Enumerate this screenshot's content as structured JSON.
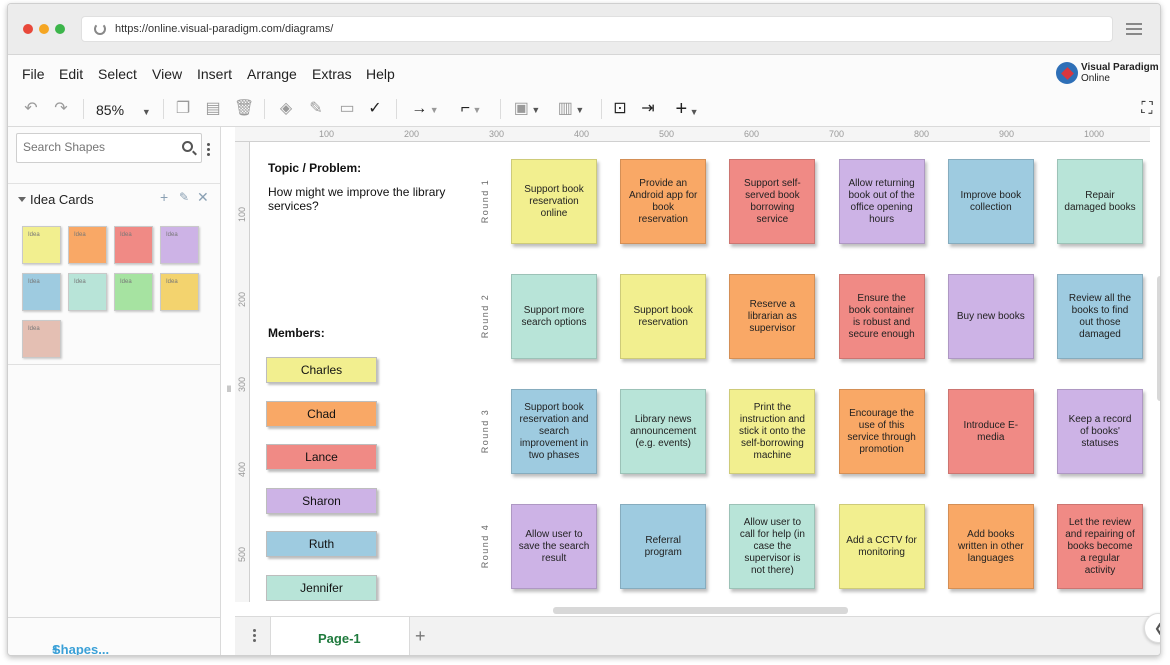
{
  "browser": {
    "url": "https://online.visual-paradigm.com/diagrams/",
    "dot_colors": [
      "#e8483a",
      "#f5a623",
      "#3cb54a"
    ]
  },
  "menu": [
    "File",
    "Edit",
    "Select",
    "View",
    "Insert",
    "Arrange",
    "Extras",
    "Help"
  ],
  "logo": {
    "line1": "Visual Paradigm",
    "line2": "Online"
  },
  "toolbar": {
    "zoom": "85%"
  },
  "sidebar": {
    "search_placeholder": "Search Shapes",
    "library_title": "Idea Cards",
    "thumb_label": "Idea",
    "thumb_colors": [
      "#f2ef8f",
      "#f9a866",
      "#f08a85",
      "#cdb3e6",
      "#9ecbe0",
      "#b8e4d8",
      "#a6e3a1",
      "#f3d36e",
      "#e4bfb3"
    ],
    "shapes_button": "Shapes..."
  },
  "ruler": {
    "top": [
      "100",
      "200",
      "300",
      "400",
      "500",
      "600",
      "700",
      "800",
      "900",
      "1000"
    ],
    "left": [
      "100",
      "200",
      "300",
      "400",
      "500"
    ]
  },
  "canvas": {
    "topic_label": "Topic / Problem:",
    "topic_text": "How might we improve the library services?",
    "members_label": "Members:",
    "members": [
      {
        "name": "Charles",
        "color": "#f2ef8f"
      },
      {
        "name": "Chad",
        "color": "#f9a866"
      },
      {
        "name": "Lance",
        "color": "#f08a85"
      },
      {
        "name": "Sharon",
        "color": "#cdb3e6"
      },
      {
        "name": "Ruth",
        "color": "#9ecbe0"
      },
      {
        "name": "Jennifer",
        "color": "#b8e4d8"
      }
    ],
    "rounds": [
      {
        "label": "Round 1",
        "cards": [
          {
            "text": "Support book reservation online",
            "color": "#f2ef8f"
          },
          {
            "text": "Provide an Android app for book reservation",
            "color": "#f9a866"
          },
          {
            "text": "Support self-served book borrowing service",
            "color": "#f08a85"
          },
          {
            "text": "Allow returning book out of the office opening hours",
            "color": "#cdb3e6"
          },
          {
            "text": "Improve book collection",
            "color": "#9ecbe0"
          },
          {
            "text": "Repair damaged books",
            "color": "#b8e4d8"
          }
        ]
      },
      {
        "label": "Round 2",
        "cards": [
          {
            "text": "Support more search options",
            "color": "#b8e4d8"
          },
          {
            "text": "Support book reservation",
            "color": "#f2ef8f"
          },
          {
            "text": "Reserve a librarian as supervisor",
            "color": "#f9a866"
          },
          {
            "text": "Ensure the book container is robust and secure enough",
            "color": "#f08a85"
          },
          {
            "text": "Buy new books",
            "color": "#cdb3e6"
          },
          {
            "text": "Review all the books to find out those damaged",
            "color": "#9ecbe0"
          }
        ]
      },
      {
        "label": "Round 3",
        "cards": [
          {
            "text": "Support book reservation and search improvement in two phases",
            "color": "#9ecbe0"
          },
          {
            "text": "Library news announcement (e.g. events)",
            "color": "#b8e4d8"
          },
          {
            "text": "Print the instruction and stick it onto the self-borrowing machine",
            "color": "#f2ef8f"
          },
          {
            "text": "Encourage the use of this service through promotion",
            "color": "#f9a866"
          },
          {
            "text": "Introduce E-media",
            "color": "#f08a85"
          },
          {
            "text": "Keep a record of books' statuses",
            "color": "#cdb3e6"
          }
        ]
      },
      {
        "label": "Round 4",
        "cards": [
          {
            "text": "Allow user to save the search result",
            "color": "#cdb3e6"
          },
          {
            "text": "Referral program",
            "color": "#9ecbe0"
          },
          {
            "text": "Allow user to call for help (in case the supervisor is not there)",
            "color": "#b8e4d8"
          },
          {
            "text": "Add a CCTV for monitoring",
            "color": "#f2ef8f"
          },
          {
            "text": "Add books written in other languages",
            "color": "#f9a866"
          },
          {
            "text": "Let the review and repairing of books become a regular activity",
            "color": "#f08a85"
          }
        ]
      }
    ]
  },
  "pagebar": {
    "page_tab": "Page-1"
  }
}
